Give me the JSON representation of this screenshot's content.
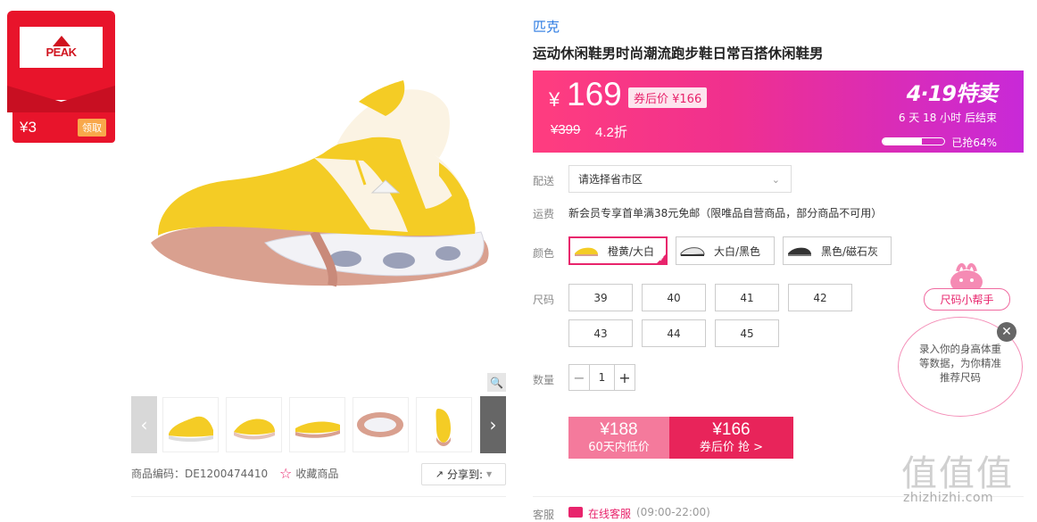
{
  "coupon_badge": {
    "brand_logo_text": "PEAK",
    "amount": "¥3",
    "claim_label": "领取"
  },
  "gallery": {
    "zoom_icon": "magnifier-icon",
    "prev_icon": "chevron-left-icon",
    "next_icon": "chevron-right-icon"
  },
  "product_meta": {
    "sku_label": "商品编码：DE1200474410",
    "favorite_label": "收藏商品",
    "share_label": "分享到:"
  },
  "product": {
    "brand": "匹克",
    "title": "运动休闲鞋男时尚潮流跑步鞋日常百搭休闲鞋男"
  },
  "price": {
    "currency": "¥",
    "current": "169",
    "coupon_tag": "券后价 ¥166",
    "original": "¥399",
    "discount": "4.2折",
    "sale_name": "4·19特卖",
    "countdown": "6 天 18 小时 后结束",
    "sold_fraction": 0.64,
    "sold_text": "已抢64%"
  },
  "delivery": {
    "label": "配送",
    "placeholder": "请选择省市区"
  },
  "freight": {
    "label": "运费",
    "text": "新会员专享首单满38元免邮（限唯品自营商品，部分商品不可用）"
  },
  "colors": {
    "label": "颜色",
    "options": [
      {
        "name": "橙黄/大白",
        "selected": true
      },
      {
        "name": "大白/黑色",
        "selected": false
      },
      {
        "name": "黑色/磁石灰",
        "selected": false
      }
    ]
  },
  "sizes": {
    "label": "尺码",
    "options": [
      "39",
      "40",
      "41",
      "42",
      "43",
      "44",
      "45"
    ]
  },
  "quantity": {
    "label": "数量",
    "value": "1",
    "minus": "−",
    "plus": "+"
  },
  "buy": {
    "low_price": "¥188",
    "low_label": "60天内低价",
    "coupon_price": "¥166",
    "coupon_label": "券后价 抢 >"
  },
  "service": {
    "label": "客服",
    "link": "在线客服",
    "hours": "(09:00-22:00)"
  },
  "size_helper": {
    "pill": "尺码小帮手",
    "text": "录入你的身高体重等数据，为你精准推荐尺码",
    "close_icon": "close-icon"
  },
  "watermark": {
    "main": "值值值",
    "url": "zhizhizhi.com"
  },
  "colors_palette": {
    "accent": "#e8246c",
    "sale_gradient_start": "#ff3d7f",
    "sale_gradient_end": "#c829d8",
    "brand_blue": "#2a7ae2"
  }
}
